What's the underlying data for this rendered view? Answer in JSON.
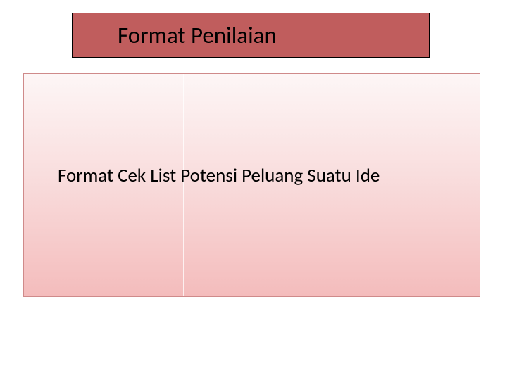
{
  "slide": {
    "title": "Format Penilaian",
    "content": "Format Cek List Potensi Peluang Suatu Ide"
  }
}
